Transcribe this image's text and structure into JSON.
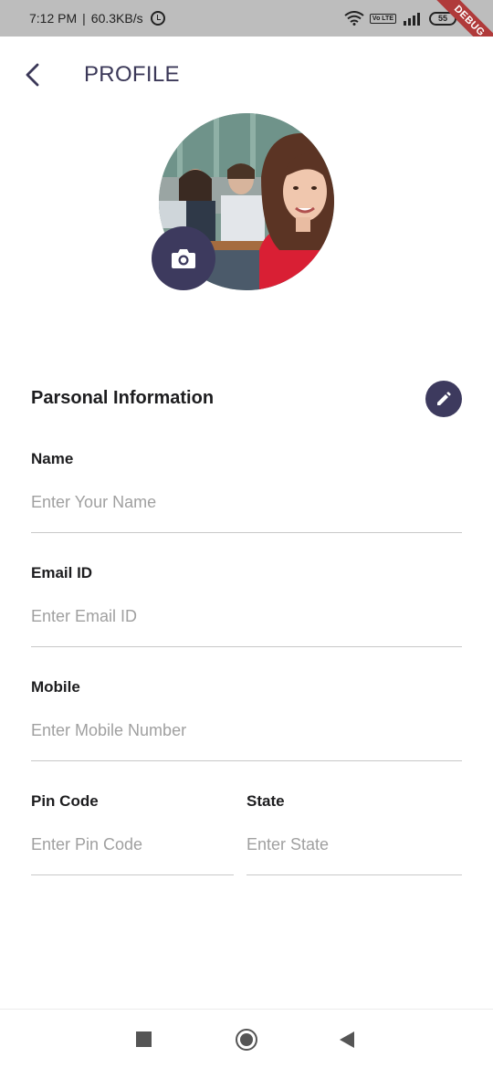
{
  "status_bar": {
    "time": "7:12 PM",
    "separator": "|",
    "network_speed": "60.3KB/s",
    "volte": "Vo LTE",
    "battery": "55",
    "debug_banner": "DEBUG"
  },
  "app_bar": {
    "title": "PROFILE",
    "back_icon": "chevron-left-icon"
  },
  "avatar": {
    "camera_icon": "camera-icon"
  },
  "personal_info": {
    "title": "Parsonal Information",
    "edit_icon": "pencil-icon"
  },
  "fields": {
    "name": {
      "label": "Name",
      "placeholder": "Enter Your Name",
      "value": ""
    },
    "email": {
      "label": "Email ID",
      "placeholder": "Enter Email ID",
      "value": ""
    },
    "mobile": {
      "label": "Mobile",
      "placeholder": "Enter Mobile Number",
      "value": ""
    },
    "pincode": {
      "label": "Pin Code",
      "placeholder": "Enter Pin Code",
      "value": ""
    },
    "state": {
      "label": "State",
      "placeholder": "Enter State",
      "value": ""
    }
  },
  "colors": {
    "accent": "#3d3a5e",
    "status_bar": "#bdbdbd",
    "placeholder": "#a0a0a0",
    "debug": "#b03a3a"
  },
  "nav_bar": {
    "recents_icon": "square-icon",
    "home_icon": "circle-icon",
    "back_icon": "triangle-back-icon"
  }
}
